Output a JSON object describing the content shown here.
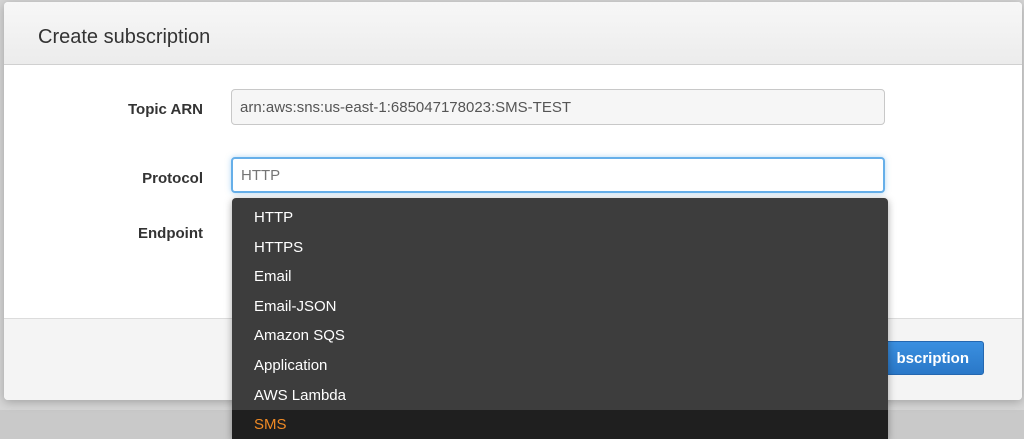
{
  "dialog": {
    "title": "Create subscription"
  },
  "form": {
    "topic_arn_label": "Topic ARN",
    "topic_arn_value": "arn:aws:sns:us-east-1:685047178023:SMS-TEST",
    "protocol_label": "Protocol",
    "protocol_placeholder": "HTTP",
    "endpoint_label": "Endpoint"
  },
  "protocol_options": [
    {
      "label": "HTTP",
      "selected": false
    },
    {
      "label": "HTTPS",
      "selected": false
    },
    {
      "label": "Email",
      "selected": false
    },
    {
      "label": "Email-JSON",
      "selected": false
    },
    {
      "label": "Amazon SQS",
      "selected": false
    },
    {
      "label": "Application",
      "selected": false
    },
    {
      "label": "AWS Lambda",
      "selected": false
    },
    {
      "label": "SMS",
      "selected": true
    }
  ],
  "footer": {
    "create_button_label": "bscription"
  },
  "colors": {
    "primary_button": "#2a78c8",
    "selected_option": "#f08a24",
    "dropdown_bg": "#3d3d3d",
    "focus_ring": "#66afe9"
  }
}
